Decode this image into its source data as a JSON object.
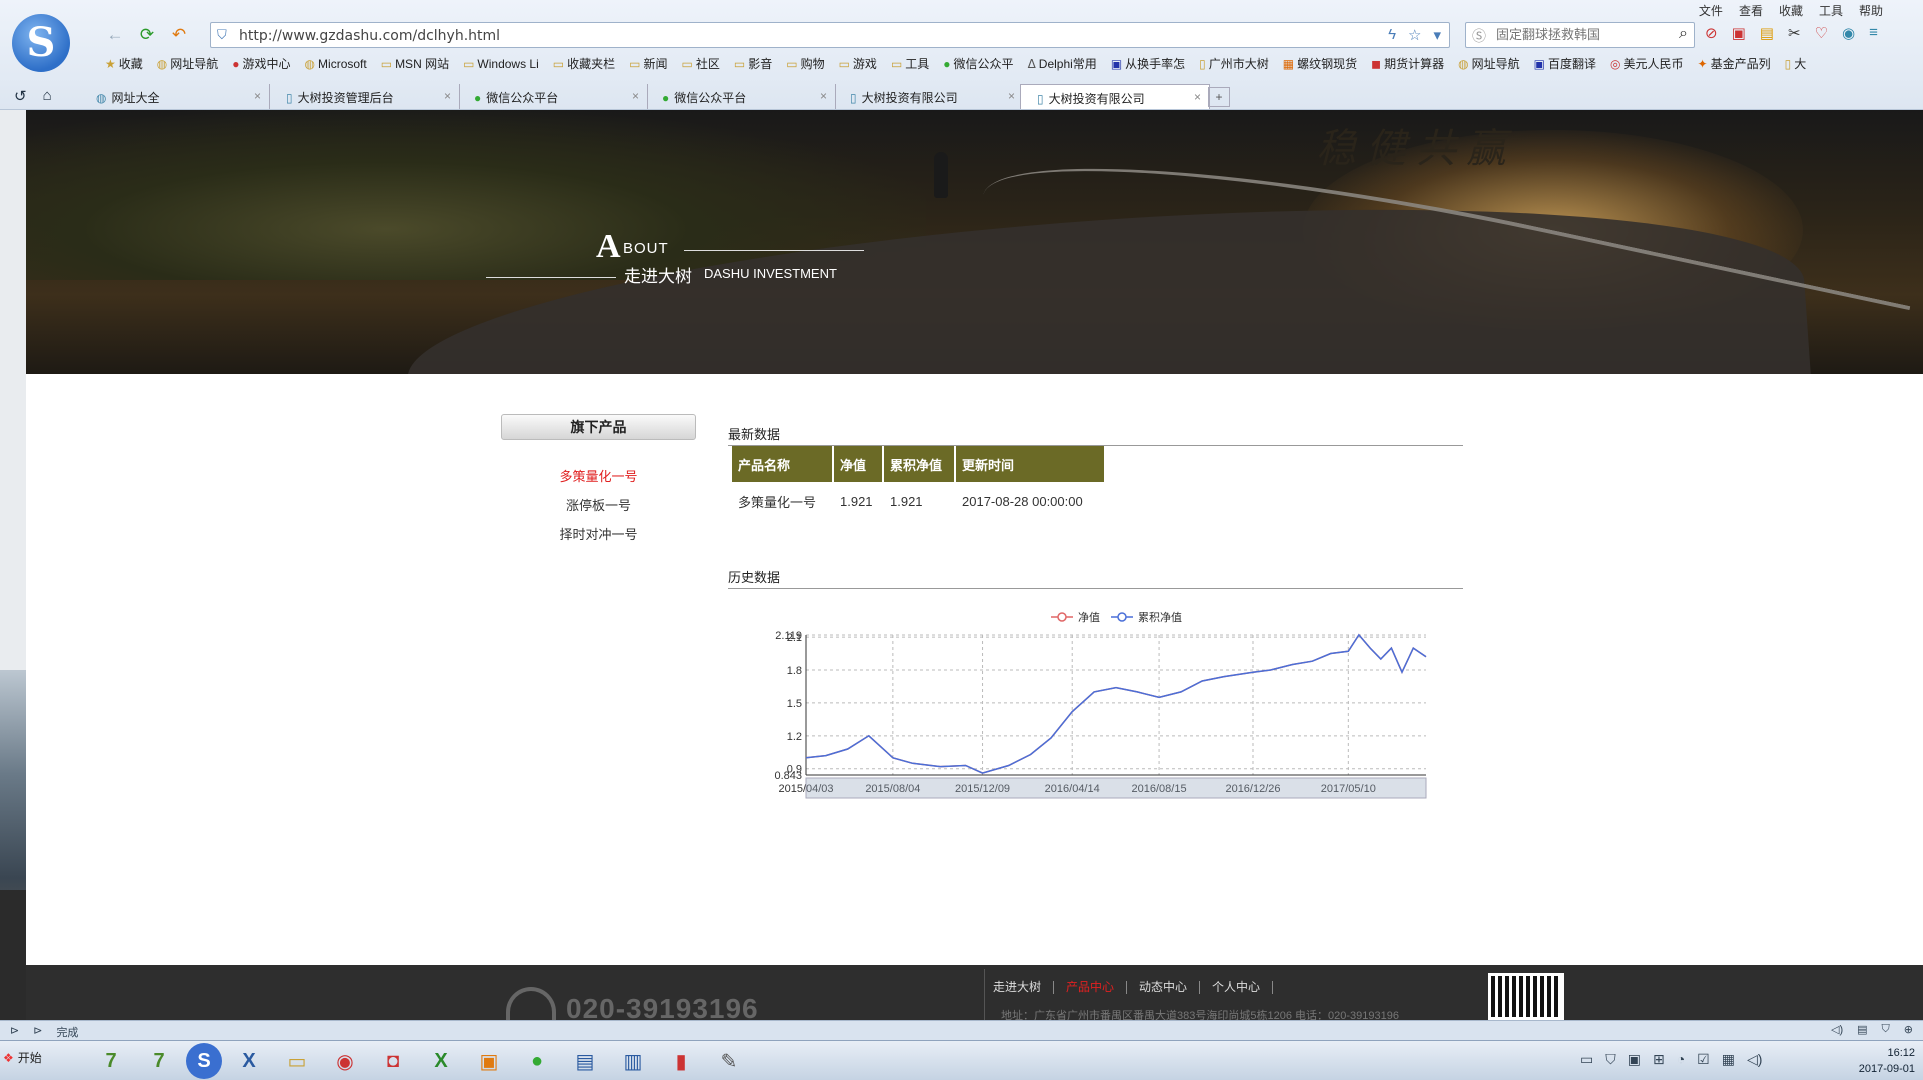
{
  "browser": {
    "top_menu": [
      "文件",
      "查看",
      "收藏",
      "工具",
      "帮助"
    ],
    "url": "http://www.gzdashu.com/dclhyh.html",
    "search_placeholder": "固定翻球拯救韩国",
    "bookmarks": [
      "收藏",
      "网址导航",
      "游戏中心",
      "Microsoft",
      "MSN 网站",
      "Windows Li",
      "收藏夹栏",
      "新闻",
      "社区",
      "影音",
      "购物",
      "游戏",
      "工具",
      "微信公众平",
      "Delphi常用",
      "从换手率怎",
      "广州市大树",
      "螺纹钢现货",
      "期货计算器",
      "网址导航",
      "百度翻译",
      "美元人民币",
      "基金产品列",
      "大"
    ],
    "tabs": [
      "网址大全",
      "大树投资管理后台",
      "微信公众平台",
      "微信公众平台",
      "大树投资有限公司",
      "大树投资有限公司"
    ],
    "active_tab": 5,
    "status": "完成"
  },
  "banner": {
    "calligraphy": "稳健共赢",
    "about_big": "A",
    "about_rest": "BOUT",
    "title_cn": "走进大树",
    "title_en": "DASHU INVESTMENT"
  },
  "sidebar": {
    "title": "旗下产品",
    "items": [
      {
        "label": "多策量化一号",
        "active": true
      },
      {
        "label": "涨停板一号",
        "active": false
      },
      {
        "label": "择时对冲一号",
        "active": false
      }
    ]
  },
  "latest": {
    "section_title": "最新数据",
    "headers": [
      "产品名称",
      "净值",
      "累积净值",
      "更新时间"
    ],
    "row": [
      "多策量化一号",
      "1.921",
      "1.921",
      "2017-08-28 00:00:00"
    ]
  },
  "history": {
    "section_title": "历史数据"
  },
  "chart_data": {
    "type": "line",
    "legend": [
      "净值",
      "累积净值"
    ],
    "legend_position": "top-center",
    "series": [
      {
        "name": "净值",
        "color": "#e06666",
        "x": [
          "2015/04/03",
          "2015/05/01",
          "2015/06/01",
          "2015/07/01",
          "2015/08/04",
          "2015/09/01",
          "2015/10/10",
          "2015/11/15",
          "2015/12/09",
          "2016/01/15",
          "2016/02/15",
          "2016/03/15",
          "2016/04/14",
          "2016/05/15",
          "2016/06/15",
          "2016/07/15",
          "2016/08/15",
          "2016/09/15",
          "2016/10/15",
          "2016/11/15",
          "2016/12/26",
          "2017/01/20",
          "2017/02/20",
          "2017/03/20",
          "2017/04/15",
          "2017/05/10",
          "2017/05/25",
          "2017/06/10",
          "2017/06/25",
          "2017/07/10",
          "2017/07/25",
          "2017/08/10",
          "2017/08/28"
        ],
        "values": [
          1.0,
          1.02,
          1.08,
          1.2,
          1.0,
          0.95,
          0.92,
          0.93,
          0.86,
          0.93,
          1.03,
          1.18,
          1.42,
          1.6,
          1.64,
          1.6,
          1.55,
          1.6,
          1.7,
          1.74,
          1.78,
          1.8,
          1.85,
          1.88,
          1.95,
          1.97,
          2.12,
          2.0,
          1.9,
          2.0,
          1.78,
          2.0,
          1.92
        ]
      },
      {
        "name": "累积净值",
        "color": "#4a6fd8",
        "x": [
          "2015/04/03",
          "2015/05/01",
          "2015/06/01",
          "2015/07/01",
          "2015/08/04",
          "2015/09/01",
          "2015/10/10",
          "2015/11/15",
          "2015/12/09",
          "2016/01/15",
          "2016/02/15",
          "2016/03/15",
          "2016/04/14",
          "2016/05/15",
          "2016/06/15",
          "2016/07/15",
          "2016/08/15",
          "2016/09/15",
          "2016/10/15",
          "2016/11/15",
          "2016/12/26",
          "2017/01/20",
          "2017/02/20",
          "2017/03/20",
          "2017/04/15",
          "2017/05/10",
          "2017/05/25",
          "2017/06/10",
          "2017/06/25",
          "2017/07/10",
          "2017/07/25",
          "2017/08/10",
          "2017/08/28"
        ],
        "values": [
          1.0,
          1.02,
          1.08,
          1.2,
          1.0,
          0.95,
          0.92,
          0.93,
          0.86,
          0.93,
          1.03,
          1.18,
          1.42,
          1.6,
          1.64,
          1.6,
          1.55,
          1.6,
          1.7,
          1.74,
          1.78,
          1.8,
          1.85,
          1.88,
          1.95,
          1.97,
          2.12,
          2.0,
          1.9,
          2.0,
          1.78,
          2.0,
          1.92
        ]
      }
    ],
    "ylim": [
      0.843,
      2.119
    ],
    "yticks": [
      "0.843",
      "0.9",
      "1.2",
      "1.5",
      "1.8",
      "2.1",
      "2.119"
    ],
    "xticks": [
      "2015/04/03",
      "2015/08/04",
      "2015/12/09",
      "2016/04/14",
      "2016/08/15",
      "2016/12/26",
      "2017/05/10"
    ],
    "grid": true
  },
  "footer": {
    "phone": "020-39193196",
    "links": [
      "走进大树",
      "产品中心",
      "动态中心",
      "个人中心"
    ],
    "active_link": 1,
    "address": "地址：广东省广州市番禺区番禺大道383号海印尚城5栋1206  电话：020-39193196"
  },
  "taskbar": {
    "start": "开始",
    "time": "16:12",
    "date": "2017-09-01"
  }
}
